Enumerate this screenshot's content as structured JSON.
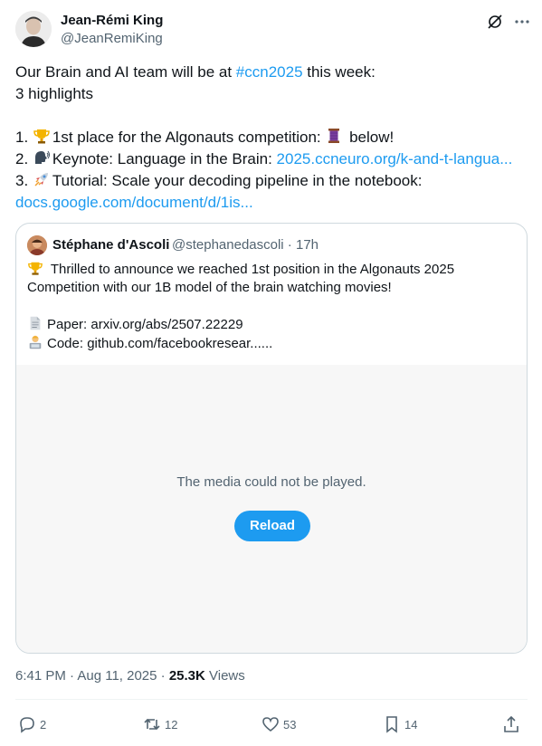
{
  "author": {
    "name": "Jean-Rémi King",
    "handle": "@JeanRemiKing"
  },
  "tweet": {
    "line1_pre": "Our Brain and AI team will be at ",
    "line1_hashtag": "#ccn2025",
    "line1_post": " this week:",
    "line2": "3 highlights",
    "item1_num": "1. ",
    "item1_text": "1st place for the Algonauts competition: ",
    "item1_post": " below!",
    "item2_num": "2. ",
    "item2_text": "Keynote: Language in the Brain: ",
    "item2_link": "2025.ccneuro.org/k-and-t-langua...",
    "item3_num": "3. ",
    "item3_text": "Tutorial: Scale your decoding pipeline in the notebook:",
    "item3_link": "docs.google.com/document/d/1is..."
  },
  "quote": {
    "name": "Stéphane d'Ascoli",
    "handle": "@stephanedascoli · 17h",
    "line1": " Thrilled to announce we reached 1st position in the Algonauts 2025",
    "line2": "Competition with our 1B model of the brain watching movies!",
    "paper": "Paper: arxiv.org/abs/2507.22229",
    "code": "Code: github.com/facebookresear......",
    "media_message": "The media could not be played.",
    "reload_label": "Reload"
  },
  "meta": {
    "timestamp": "6:41 PM · Aug 11, 2025 · ",
    "views_count": "25.3K",
    "views_label": " Views"
  },
  "actions": {
    "replies": "2",
    "reposts": "12",
    "likes": "53",
    "bookmarks": "14"
  }
}
